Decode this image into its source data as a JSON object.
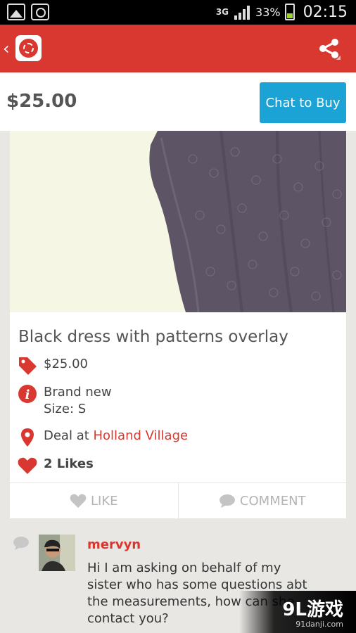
{
  "status_bar": {
    "network": "3G",
    "battery_percent": "33%",
    "time": "02:15"
  },
  "header": {
    "back_icon": "chevron-left-icon",
    "app_icon": "camera-app-icon",
    "share_icon": "share-icon"
  },
  "price_bar": {
    "price": "$25.00",
    "chat_button": "Chat to Buy"
  },
  "listing": {
    "title": "Black dress with patterns overlay",
    "price": "$25.00",
    "condition": "Brand new",
    "size": "Size: S",
    "deal_prefix": "Deal at ",
    "deal_location": "Holland Village",
    "likes": "2 Likes",
    "like_button": "LIKE",
    "comment_button": "COMMENT"
  },
  "comment": {
    "user": "mervyn",
    "text": "Hi I am asking on behalf of my sister who has some questions abt the measurements, how can she contact you?"
  },
  "watermark": {
    "logo": "9L游戏",
    "url": "91danji.com"
  },
  "colors": {
    "brand_red": "#d8382f",
    "chat_blue": "#1ba3d6"
  }
}
